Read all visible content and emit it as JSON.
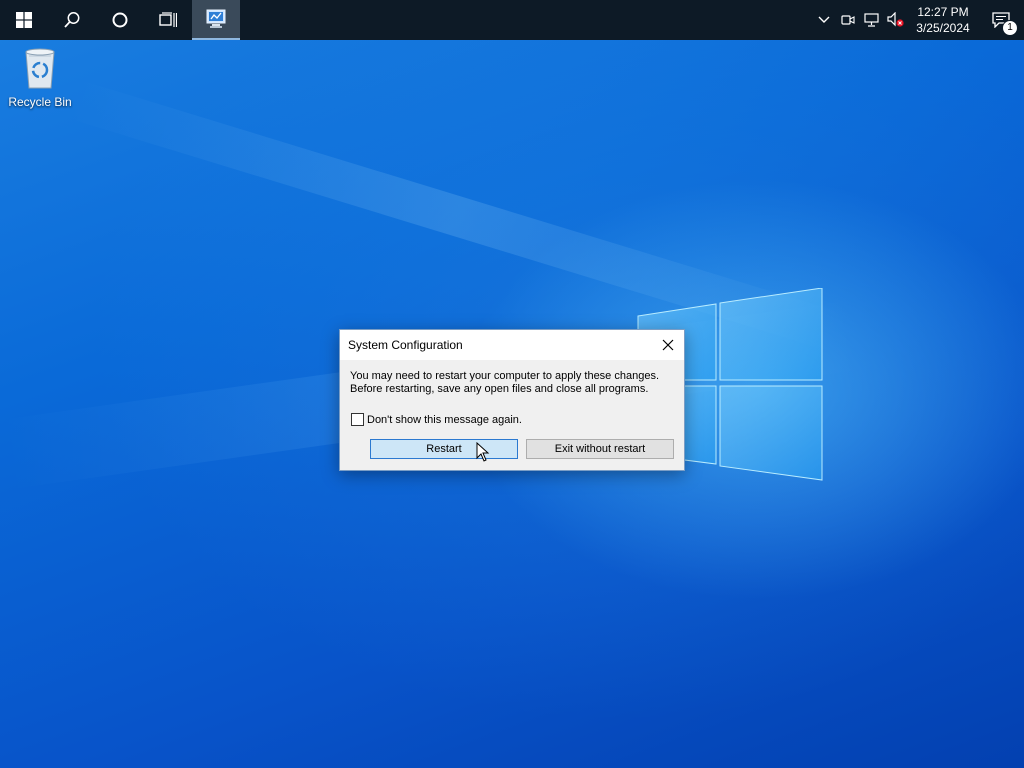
{
  "desktop": {
    "icons": [
      {
        "label": "Recycle Bin",
        "icon": "recycle-bin-icon"
      }
    ]
  },
  "taskbar": {
    "start": "windows-start-icon",
    "search": "search-icon",
    "cortana": "cortana-circle-icon",
    "task_view": "task-view-icon",
    "pinned_app": "system-configuration-app-icon",
    "tray": {
      "chevron": "chevron-up-icon",
      "icons": [
        "meet-now-icon",
        "network-icon",
        "volume-muted-icon"
      ],
      "time": "12:27 PM",
      "date": "3/25/2024",
      "notification_count": "1"
    }
  },
  "dialog": {
    "title": "System Configuration",
    "message_line1": "You may need to restart your computer to apply these changes.",
    "message_line2": "Before restarting, save any open files and close all programs.",
    "checkbox_label": "Don't show this message again.",
    "checkbox_checked": false,
    "restart_label": "Restart",
    "exit_label": "Exit without restart"
  },
  "colors": {
    "taskbar_bg": "#0d1a26",
    "desktop_accent": "#0a6ad8",
    "default_button": "#cde6f7"
  }
}
